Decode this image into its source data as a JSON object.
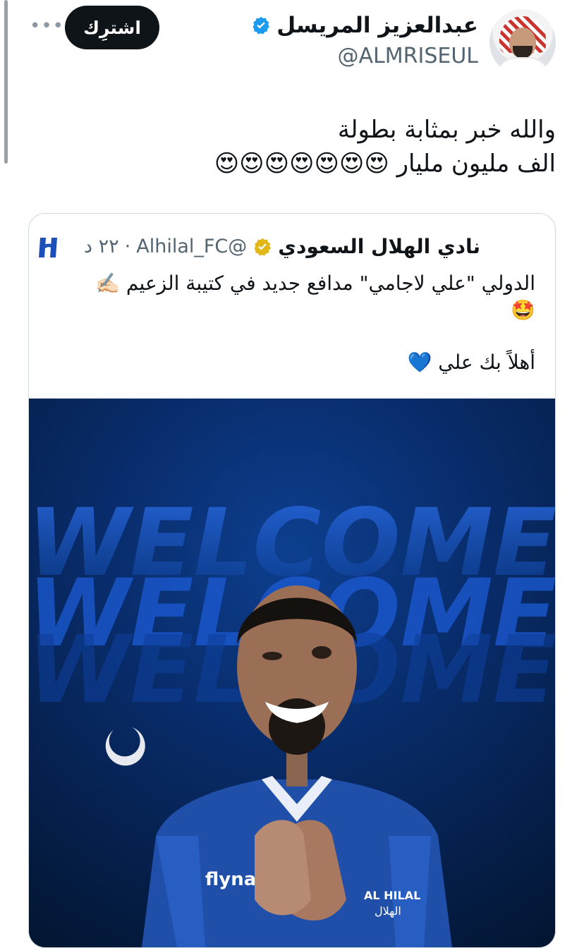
{
  "header": {
    "display_name": "عبدالعزيز المريسل",
    "handle": "@ALMRISEUL",
    "subscribe_label": "اشترِك",
    "more_label": "•••"
  },
  "tweet": {
    "lines": [
      "والله خبر بمثابة بطولة",
      "الف مليون مليار 😍😍😍😍😍😍😍"
    ]
  },
  "quote": {
    "club_name": "نادي الهلال السعودي",
    "club_handle": "@Alhilal_FC",
    "dot": "·",
    "time": "٢٢ د",
    "text_lines": [
      "الدولي \"علي لاجامي\" مدافع جديد في كتيبة الزعيم ✍🏻",
      "🤩",
      "",
      "أهلاً بك علي 💙"
    ]
  },
  "media": {
    "welcome_text": "WELCOME",
    "jersey_sponsor": "flynas",
    "badge_text": "AL HILAL",
    "badge_text_ar": "الهلال"
  },
  "colors": {
    "verified_blue": "#1d9bf0",
    "gold_badge": "#e2b719",
    "accent_dark": "#0f1419",
    "hilal_blue": "#0b3d91"
  }
}
